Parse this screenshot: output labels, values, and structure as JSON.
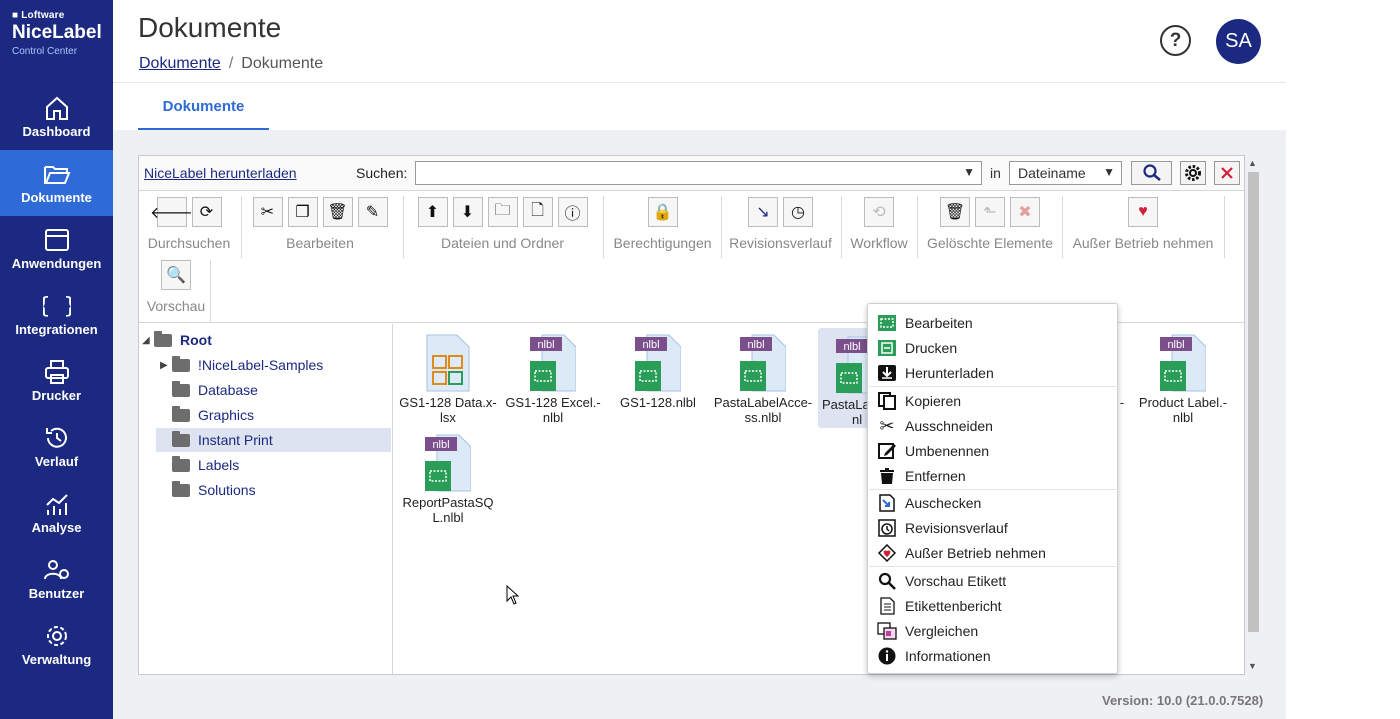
{
  "brand": {
    "company": "Loftware",
    "product": "NiceLabel",
    "sub": "Control Center"
  },
  "sidebar": {
    "items": [
      {
        "label": "Dashboard",
        "icon": "home-icon"
      },
      {
        "label": "Dokumente",
        "icon": "folder-open-icon"
      },
      {
        "label": "Anwendungen",
        "icon": "window-icon"
      },
      {
        "label": "Integrationen",
        "icon": "braces-icon"
      },
      {
        "label": "Drucker",
        "icon": "printer-icon"
      },
      {
        "label": "Verlauf",
        "icon": "history-icon"
      },
      {
        "label": "Analyse",
        "icon": "analytics-icon"
      },
      {
        "label": "Benutzer",
        "icon": "users-icon"
      },
      {
        "label": "Verwaltung",
        "icon": "gear-icon"
      }
    ]
  },
  "header": {
    "title": "Dokumente",
    "breadcrumb": {
      "link": "Dokumente",
      "sep": "/",
      "current": "Dokumente"
    },
    "help": "?",
    "avatar": "SA"
  },
  "tabs": {
    "active": "Dokumente"
  },
  "search": {
    "download_link": "NiceLabel herunterladen",
    "label": "Suchen:",
    "value": "",
    "in_label": "in",
    "field": "Dateiname"
  },
  "ribbon": {
    "groups": [
      {
        "label": "Durchsuchen"
      },
      {
        "label": "Bearbeiten"
      },
      {
        "label": "Dateien und Ordner"
      },
      {
        "label": "Berechtigungen"
      },
      {
        "label": "Revisionsverlauf"
      },
      {
        "label": "Workflow"
      },
      {
        "label": "Gelöschte Elemente"
      },
      {
        "label": "Außer Betrieb nehmen"
      },
      {
        "label": "Vorschau"
      }
    ]
  },
  "tree": {
    "root": "Root",
    "items": [
      "!NiceLabel-Samples",
      "Database",
      "Graphics",
      "Instant Print",
      "Labels",
      "Solutions"
    ],
    "selected": "Instant Print"
  },
  "files": [
    {
      "name_line1": "GS1-128 Data.x-",
      "name_line2": "lsx",
      "type": "xlsx"
    },
    {
      "name_line1": "GS1-128 Excel.-",
      "name_line2": "nlbl",
      "type": "nlbl"
    },
    {
      "name_line1": "GS1-128.nlbl",
      "name_line2": "",
      "type": "nlbl"
    },
    {
      "name_line1": "PastaLabelAcce-",
      "name_line2": "ss.nlbl",
      "type": "nlbl"
    },
    {
      "name_line1": "PastaLa",
      "name_line2": "nl",
      "type": "nlbl"
    },
    {
      "name_line1": "-",
      "name_line2": "",
      "type": "partial"
    },
    {
      "name_line1": "Product Label.-",
      "name_line2": "nlbl",
      "type": "nlbl"
    },
    {
      "name_line1": "ReportPastaSQ",
      "name_line2": "L.nlbl",
      "type": "nlbl"
    }
  ],
  "file_badge": "nlbl",
  "context_menu": [
    {
      "label": "Bearbeiten",
      "icon": "edit-label-icon"
    },
    {
      "label": "Drucken",
      "icon": "print-label-icon"
    },
    {
      "label": "Herunterladen",
      "icon": "download-icon"
    },
    {
      "label": "Kopieren",
      "icon": "copy-icon"
    },
    {
      "label": "Ausschneiden",
      "icon": "scissors-icon"
    },
    {
      "label": "Umbenennen",
      "icon": "rename-icon"
    },
    {
      "label": "Entfernen",
      "icon": "trash-icon"
    },
    {
      "label": "Auschecken",
      "icon": "checkout-icon"
    },
    {
      "label": "Revisionsverlauf",
      "icon": "revision-history-icon"
    },
    {
      "label": "Außer Betrieb nehmen",
      "icon": "retire-icon"
    },
    {
      "label": "Vorschau Etikett",
      "icon": "magnifier-icon"
    },
    {
      "label": "Etikettenbericht",
      "icon": "report-icon"
    },
    {
      "label": "Vergleichen",
      "icon": "compare-icon"
    },
    {
      "label": "Informationen",
      "icon": "info-icon"
    }
  ],
  "version": "Version: 10.0 (21.0.0.7528)",
  "colors": {
    "sidebar": "#1b2a80",
    "active": "#2f6bd6",
    "green": "#2a9d59",
    "purple": "#7b4e8c"
  }
}
